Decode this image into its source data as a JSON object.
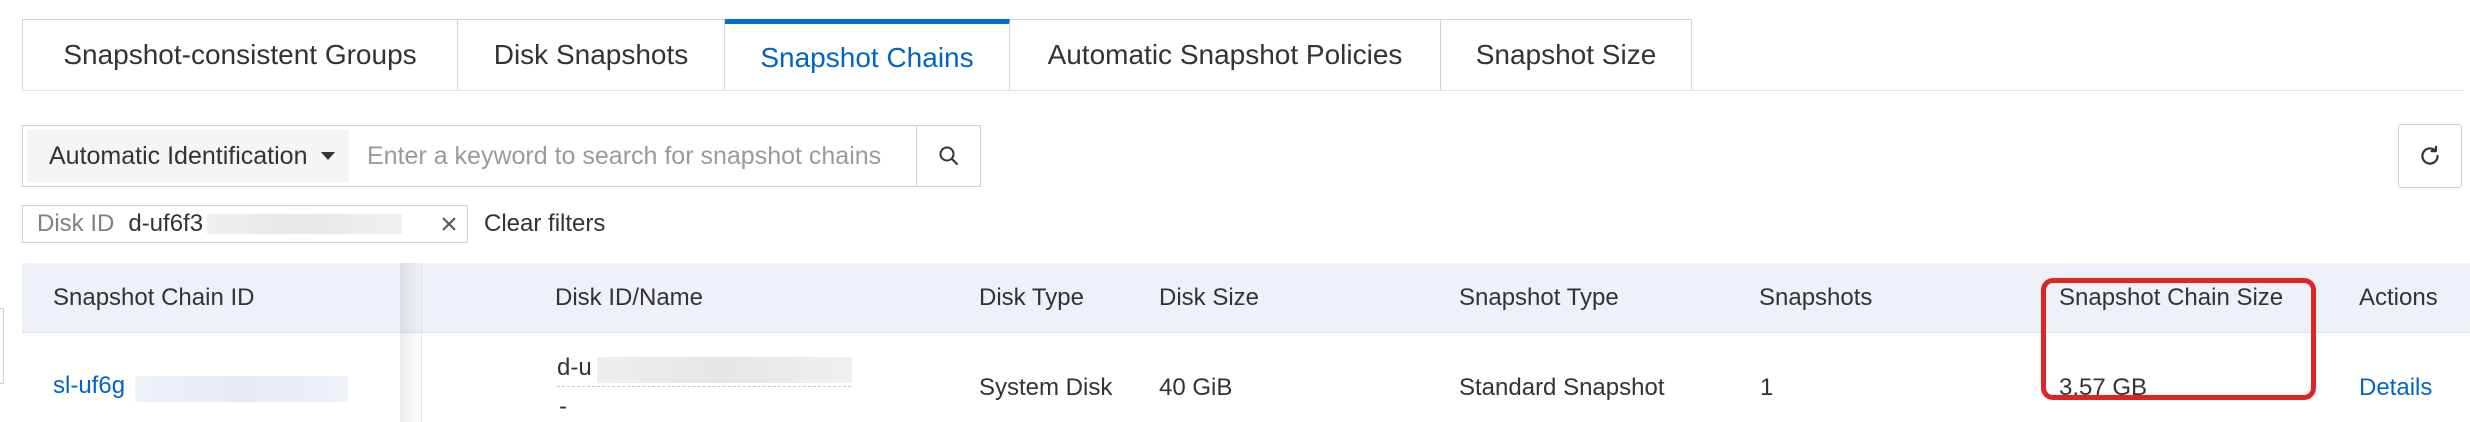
{
  "tabs": [
    {
      "label": "Snapshot-consistent Groups",
      "active": false
    },
    {
      "label": "Disk Snapshots",
      "active": false
    },
    {
      "label": "Snapshot Chains",
      "active": true
    },
    {
      "label": "Automatic Snapshot Policies",
      "active": false
    },
    {
      "label": "Snapshot Size",
      "active": false
    }
  ],
  "search": {
    "select_label": "Automatic Identification",
    "placeholder": "Enter a keyword to search for snapshot chains",
    "value": "",
    "search_icon": "search-icon",
    "refresh_icon": "refresh-icon"
  },
  "filter_chip": {
    "key": "Disk ID",
    "value": "d-uf6f3",
    "close_icon": "close-icon"
  },
  "clear_filters_label": "Clear filters",
  "table": {
    "headers": [
      "Snapshot Chain ID",
      "Disk ID/Name",
      "Disk Type",
      "Disk Size",
      "Snapshot Type",
      "Snapshots",
      "Snapshot Chain Size",
      "Actions"
    ],
    "rows": [
      {
        "chain_id": "sl-uf6g",
        "disk_id": "d-u",
        "disk_name": "-",
        "disk_type": "System Disk",
        "disk_size": "40 GiB",
        "snapshot_type": "Standard Snapshot",
        "snapshots": "1",
        "chain_size": "3.57 GB",
        "action": "Details"
      }
    ]
  },
  "colors": {
    "accent": "#0064c8",
    "highlight_box": "#e02424",
    "header_bg": "#eef1f7"
  }
}
